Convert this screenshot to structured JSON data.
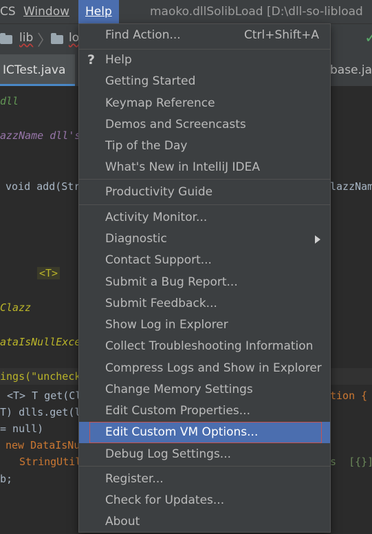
{
  "menubar": {
    "items": [
      "CS",
      "Window",
      "Help"
    ],
    "window_title": "maoko.dllSolibLoad [D:\\dll-so-libload"
  },
  "navbar": {
    "crumbs": [
      "lib",
      "lo"
    ]
  },
  "tabs": [
    "ICTest.java",
    "base.java"
  ],
  "editor": {
    "lines": [
      {
        "t": "dll"
      },
      {
        "t": "azzName dll's"
      },
      {
        "t": "void add(Str",
        "end": "lazzNam"
      },
      {
        "t": "<T>"
      },
      {
        "t": "Clazz"
      },
      {
        "t": "ataIsNullExcep"
      },
      {
        "t": "ings(\"uncheck"
      },
      {
        "t": "<T> T get(Cl",
        "end": "tion {"
      },
      {
        "t": "T) dlls.get(l"
      },
      {
        "t": "= null)"
      },
      {
        "t": "new DataIsNu"
      },
      {
        "t": "StringUtil",
        "end": "s  [{}]"
      },
      {
        "t": "b;"
      }
    ]
  },
  "help_menu": {
    "items": [
      {
        "label": "Find Action...",
        "mnemonic": "F",
        "shortcut": "Ctrl+Shift+A"
      },
      {
        "label": "Help",
        "mnemonic": "H",
        "icon": "question-mark-icon"
      },
      {
        "label": "Getting Started",
        "mnemonic": "G"
      },
      {
        "label": "Keymap Reference",
        "mnemonic": "K"
      },
      {
        "label": "Demos and Screencasts",
        "mnemonic": "D"
      },
      {
        "label": "Tip of the Day",
        "mnemonic": "T"
      },
      {
        "label": "What's New in IntelliJ IDEA",
        "mnemonic": "N"
      },
      {
        "label": "Productivity Guide",
        "mnemonic": "P"
      },
      {
        "label": "Activity Monitor..."
      },
      {
        "label": "Diagnostic",
        "submenu": true
      },
      {
        "label": "Contact Support...",
        "mnemonic": "S"
      },
      {
        "label": "Submit a Bug Report..."
      },
      {
        "label": "Submit Feedback...",
        "mnemonic": "F"
      },
      {
        "label": "Show Log in Explorer"
      },
      {
        "label": "Collect Troubleshooting Information"
      },
      {
        "label": "Compress Logs and Show in Explorer"
      },
      {
        "label": "Change Memory Settings"
      },
      {
        "label": "Edit Custom Properties..."
      },
      {
        "label": "Edit Custom VM Options...",
        "selected": true
      },
      {
        "label": "Debug Log Settings...",
        "mnemonic": "b"
      },
      {
        "label": "Register...",
        "mnemonic": "R"
      },
      {
        "label": "Check for Updates...",
        "mnemonic": "C"
      },
      {
        "label": "About",
        "mnemonic": "A"
      }
    ]
  },
  "colors": {
    "menu_bg": "#3c3f41",
    "selection": "#4b6eaf",
    "focus_border": "#c75450",
    "editor_bg": "#2b2b2b"
  }
}
